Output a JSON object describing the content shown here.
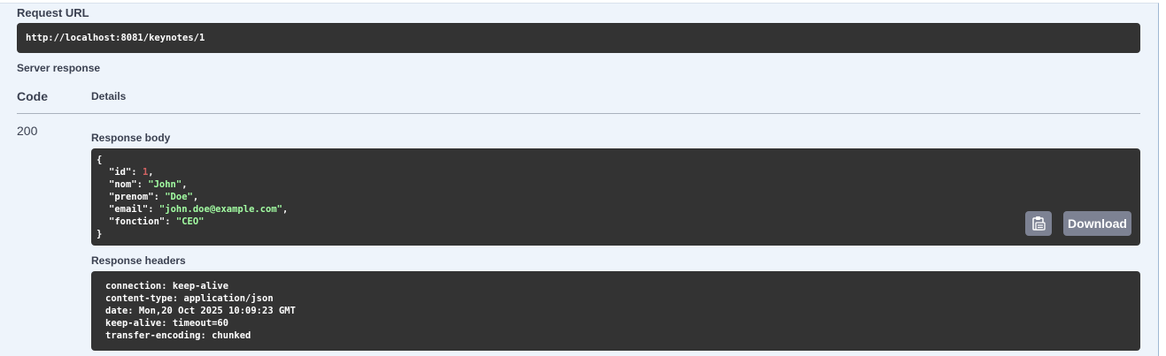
{
  "request_url": {
    "label": "Request URL",
    "value": "http://localhost:8081/keynotes/1"
  },
  "server_response": {
    "label": "Server response",
    "columns": {
      "code": "Code",
      "details": "Details"
    },
    "status_code": "200",
    "response_body": {
      "label": "Response body",
      "open_brace": "{",
      "close_brace": "}",
      "fields": [
        {
          "key": "\"id\"",
          "value": "1",
          "type": "num",
          "comma": ","
        },
        {
          "key": "\"nom\"",
          "value": "\"John\"",
          "type": "str",
          "comma": ","
        },
        {
          "key": "\"prenom\"",
          "value": "\"Doe\"",
          "type": "str",
          "comma": ","
        },
        {
          "key": "\"email\"",
          "value": "\"john.doe@example.com\"",
          "type": "str",
          "comma": ","
        },
        {
          "key": "\"fonction\"",
          "value": "\"CEO\"",
          "type": "str",
          "comma": ""
        }
      ],
      "copy_icon": "clipboard-icon",
      "download_label": "Download"
    },
    "response_headers": {
      "label": "Response headers",
      "lines": [
        "connection: keep-alive",
        "content-type: application/json",
        "date: Mon,20 Oct 2025 10:09:23 GMT",
        "keep-alive: timeout=60",
        "transfer-encoding: chunked"
      ]
    }
  },
  "colors": {
    "panel_bg": "#eef4fb",
    "code_bg": "#333333",
    "string": "#a2fca2",
    "number": "#d36363",
    "button_bg": "#7d8293"
  }
}
